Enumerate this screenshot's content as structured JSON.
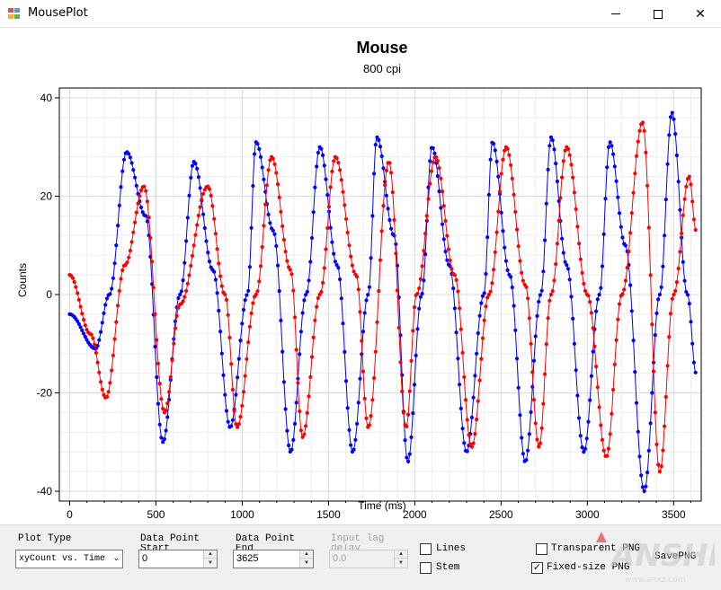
{
  "window": {
    "title": "MousePlot"
  },
  "plot": {
    "title": "Mouse",
    "subtitle": "800 cpi"
  },
  "chart_data": {
    "type": "line",
    "xlabel": "Time (ms)",
    "ylabel": "Counts",
    "xlim": [
      -60,
      3660
    ],
    "ylim": [
      -42,
      42
    ],
    "x_ticks": [
      "0",
      "500",
      "1000",
      "1500",
      "2000",
      "2500",
      "3000",
      "3500"
    ],
    "y_ticks": [
      "40",
      "20",
      "0",
      "-20",
      "-40"
    ],
    "grid": true,
    "series": [
      {
        "color": "#0000ff",
        "x": [
          0,
          150,
          230,
          330,
          440,
          540,
          640,
          720,
          830,
          930,
          1030,
          1080,
          1180,
          1280,
          1370,
          1450,
          1550,
          1640,
          1730,
          1780,
          1880,
          1960,
          2040,
          2100,
          2200,
          2300,
          2400,
          2450,
          2550,
          2640,
          2730,
          2790,
          2880,
          2980,
          3070,
          3130,
          3220,
          3330,
          3420,
          3490,
          3580,
          3630
        ],
        "y": [
          -4,
          -11,
          0,
          29,
          16,
          -30,
          0,
          27,
          5,
          -27,
          0,
          31,
          13,
          -32,
          0,
          30,
          6,
          -32,
          0,
          32,
          12,
          -34,
          0,
          30,
          6,
          -32,
          0,
          31,
          4,
          -34,
          0,
          32,
          6,
          -32,
          0,
          31,
          10,
          -40,
          0,
          37,
          0,
          -16
        ]
      },
      {
        "color": "#ff0000",
        "x": [
          0,
          120,
          210,
          320,
          430,
          550,
          640,
          800,
          900,
          970,
          1080,
          1170,
          1280,
          1350,
          1450,
          1540,
          1660,
          1730,
          1850,
          1950,
          2010,
          2120,
          2230,
          2330,
          2430,
          2530,
          2640,
          2720,
          2790,
          2880,
          3000,
          3110,
          3200,
          3320,
          3420,
          3500,
          3590,
          3630
        ],
        "y": [
          4,
          -8,
          -21,
          6,
          22,
          -24,
          -2,
          22,
          0,
          -27,
          0,
          28,
          5,
          -29,
          0,
          28,
          4,
          -27,
          27,
          -27,
          0,
          28,
          4,
          -31,
          0,
          30,
          2,
          -31,
          0,
          30,
          0,
          -33,
          0,
          35,
          -36,
          0,
          24,
          13
        ]
      }
    ]
  },
  "controls": {
    "plot_type_label": "Plot Type",
    "plot_type_value": "xyCount vs. Time",
    "dp_start_label_1": "Data Point",
    "dp_start_label_2": "Start",
    "dp_start_value": "0",
    "dp_end_label_1": "Data Point",
    "dp_end_label_2": "End",
    "dp_end_value": "3625",
    "lag_label_1": "Input lag",
    "lag_label_2": "delay",
    "lag_value": "0.0",
    "lines_label": "Lines",
    "lines_checked": false,
    "stem_label": "Stem",
    "stem_checked": false,
    "transparent_label": "Transparent PNG",
    "transparent_checked": false,
    "fixed_size_label": "Fixed-size PNG",
    "fixed_size_checked": true,
    "save_label": "SavePNG"
  }
}
